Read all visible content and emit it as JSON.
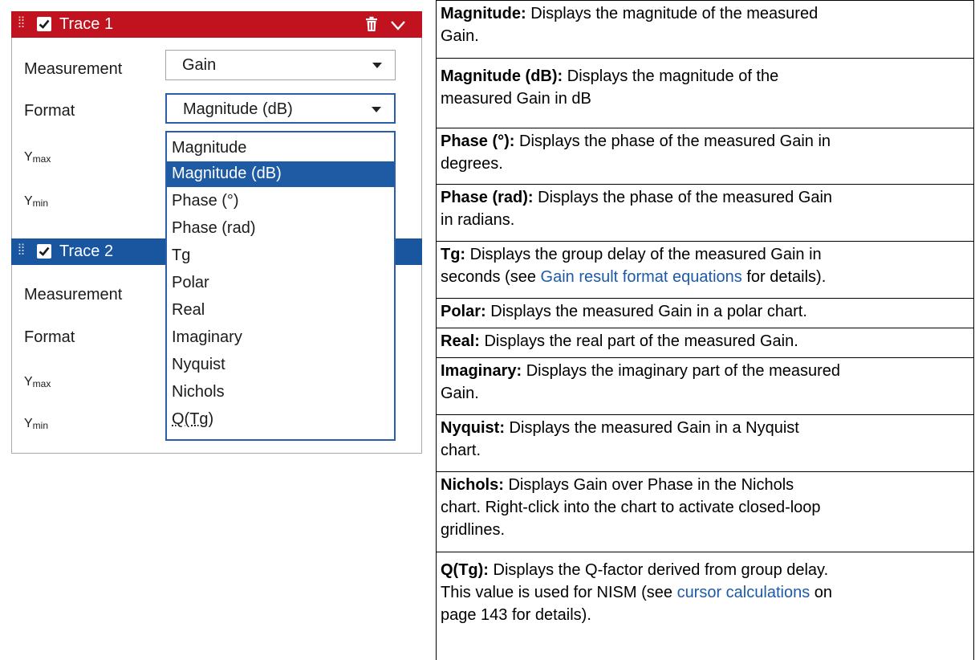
{
  "panel": {
    "trace1": {
      "title": "Trace 1",
      "measurement_label": "Measurement",
      "measurement_value": "Gain",
      "format_label": "Format",
      "format_value": "Magnitude (dB)",
      "ymax_main": "Y",
      "ymax_sub": "max",
      "ymin_main": "Y",
      "ymin_sub": "min"
    },
    "trace2": {
      "title": "Trace 2",
      "measurement_label": "Measurement",
      "format_label": "Format",
      "ymax_main": "Y",
      "ymax_sub": "max",
      "ymin_main": "Y",
      "ymin_sub": "min"
    },
    "dropdown_options": [
      "Magnitude",
      "Magnitude (dB)",
      "Phase (°)",
      "Phase (rad)",
      "Tg",
      "Polar",
      "Real",
      "Imaginary",
      "Nyquist",
      "Nichols",
      "Q(Tg)"
    ],
    "selected_option": "Magnitude (dB)",
    "colors": {
      "trace1_header": "#c1121f",
      "trace2_header": "#1a56a0",
      "selection": "#1f5ba5",
      "focus_border": "#2b5ea8"
    }
  },
  "descriptions": [
    {
      "term": "Magnitude:",
      "line1": " Displays the magnitude of the measured",
      "line2": "Gain."
    },
    {
      "term": "Magnitude (dB):",
      "line1": " Displays the magnitude of the",
      "line2": "measured Gain in dB"
    },
    {
      "term": "Phase (°):",
      "line1": " Displays the phase of the measured Gain in",
      "line2": "degrees."
    },
    {
      "term": "Phase (rad):",
      "line1": " Displays the phase of the measured Gain",
      "line2": "in radians."
    },
    {
      "term": "Tg:",
      "line1": " Displays the group delay of the measured Gain in",
      "line2_pre": "seconds (see ",
      "line2_link": "Gain result format equations",
      "line2_post": " for details)."
    },
    {
      "term": "Polar:",
      "line1": " Displays the measured Gain in a polar chart."
    },
    {
      "term": "Real:",
      "line1": " Displays the real part of the measured Gain."
    },
    {
      "term": "Imaginary:",
      "line1": " Displays the imaginary part of the measured",
      "line2": "Gain."
    },
    {
      "term": "Nyquist:",
      "line1": " Displays the measured Gain in a Nyquist",
      "line2": "chart."
    },
    {
      "term": "Nichols:",
      "line1": " Displays Gain over Phase in the Nichols",
      "line2": "chart. Right-click into the chart to activate closed-loop",
      "line3": "gridlines."
    },
    {
      "term": "Q(Tg):",
      "line1": " Displays the Q-factor derived from group delay.",
      "line2_pre": "This value is used for NISM (see ",
      "line2_link": "cursor calculations",
      "line2_post": " on",
      "line3": "page 143 for details)."
    }
  ]
}
